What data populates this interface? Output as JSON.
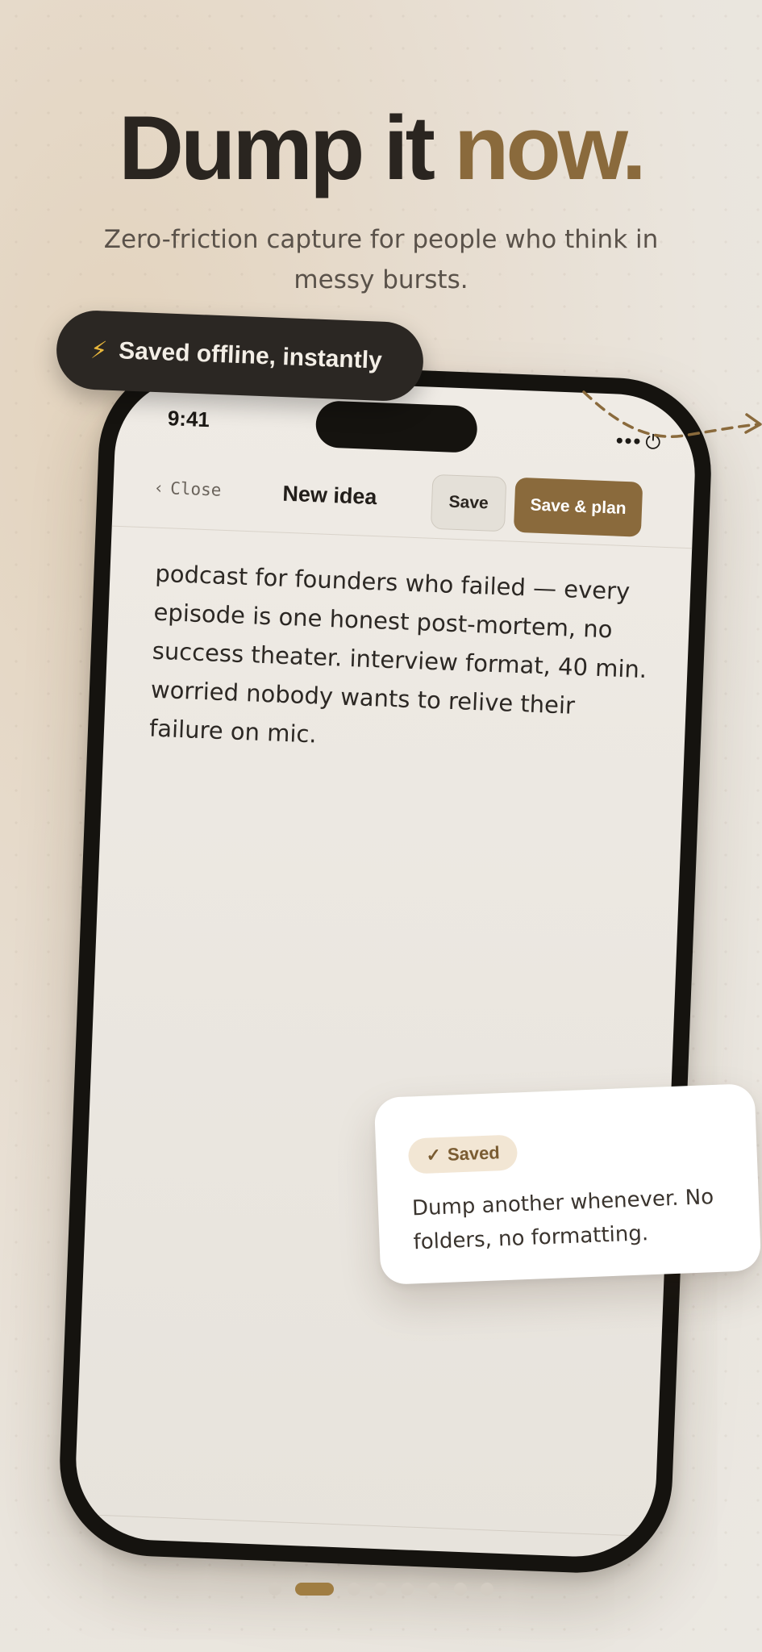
{
  "hero": {
    "headline_main": "Dump it ",
    "headline_accent": "now.",
    "subhead": "Zero-friction capture for people who think in messy bursts."
  },
  "toast": {
    "icon": "lightning-bolt-icon",
    "label": "Saved offline, instantly"
  },
  "phone": {
    "status_time": "9:41",
    "nav": {
      "close_chevron": "‹",
      "close_label": "Close",
      "title": "New idea",
      "save_label": "Save",
      "save_plan_label": "Save & plan"
    },
    "note_text": "podcast for founders who failed — every episode is one honest post-mortem, no success theater. interview format, 40 min. worried nobody wants to relive their failure on mic."
  },
  "card": {
    "badge_check": "✓",
    "badge_label": "Saved",
    "message": "Dump another whenever. No folders, no formatting."
  },
  "pager": {
    "total_pages": 8,
    "active_index": 1
  },
  "colors": {
    "accent": "#8a6a3c",
    "toast_bg": "#2b2723",
    "badge_bg": "#f2e6d4"
  }
}
